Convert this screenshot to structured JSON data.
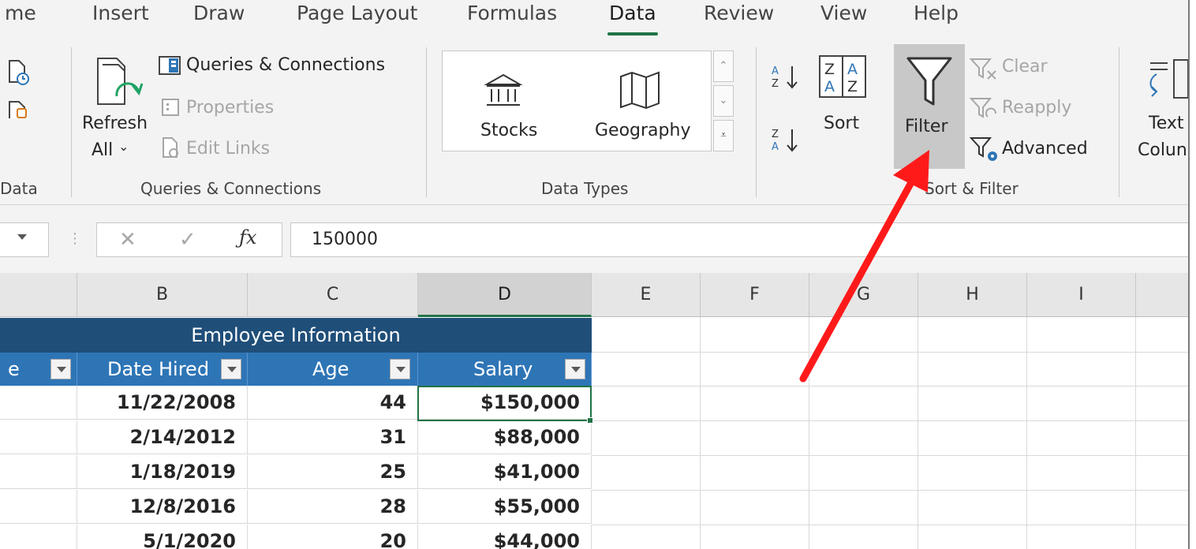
{
  "tabs": [
    {
      "label": "me"
    },
    {
      "label": "Insert"
    },
    {
      "label": "Draw"
    },
    {
      "label": "Page Layout"
    },
    {
      "label": "Formulas"
    },
    {
      "label": "Data"
    },
    {
      "label": "Review"
    },
    {
      "label": "View"
    },
    {
      "label": "Help"
    }
  ],
  "active_tab": "Data",
  "ribbon": {
    "get_data_group_label": "Data",
    "refresh_line1": "Refresh",
    "refresh_line2": "All",
    "queries_connections": "Queries & Connections",
    "properties": "Properties",
    "edit_links": "Edit Links",
    "queries_group_label": "Queries & Connections",
    "stocks": "Stocks",
    "geography": "Geography",
    "data_types_group_label": "Data Types",
    "sort": "Sort",
    "filter": "Filter",
    "clear": "Clear",
    "reapply": "Reapply",
    "advanced": "Advanced",
    "sort_filter_group_label": "Sort & Filter",
    "text_line1": "Text",
    "text_line2": "Colun"
  },
  "formula_bar": {
    "value": "150000"
  },
  "columns": [
    "B",
    "C",
    "D",
    "E",
    "F",
    "G",
    "H",
    "I"
  ],
  "selected_column": "D",
  "table": {
    "title": "Employee Information",
    "headers": [
      "e",
      "Date Hired",
      "Age",
      "Salary"
    ],
    "rows": [
      {
        "date": "11/22/2008",
        "age": "44",
        "salary": "$150,000"
      },
      {
        "date": "2/14/2012",
        "age": "31",
        "salary": "$88,000"
      },
      {
        "date": "1/18/2019",
        "age": "25",
        "salary": "$41,000"
      },
      {
        "date": "12/8/2016",
        "age": "28",
        "salary": "$55,000"
      },
      {
        "date": "5/1/2020",
        "age": "20",
        "salary": "$44,000"
      }
    ]
  },
  "colors": {
    "accent": "#217346",
    "table_title_bg": "#1f4e79",
    "table_header_bg": "#2e75b6",
    "annotation_arrow": "#ff1a1a"
  }
}
